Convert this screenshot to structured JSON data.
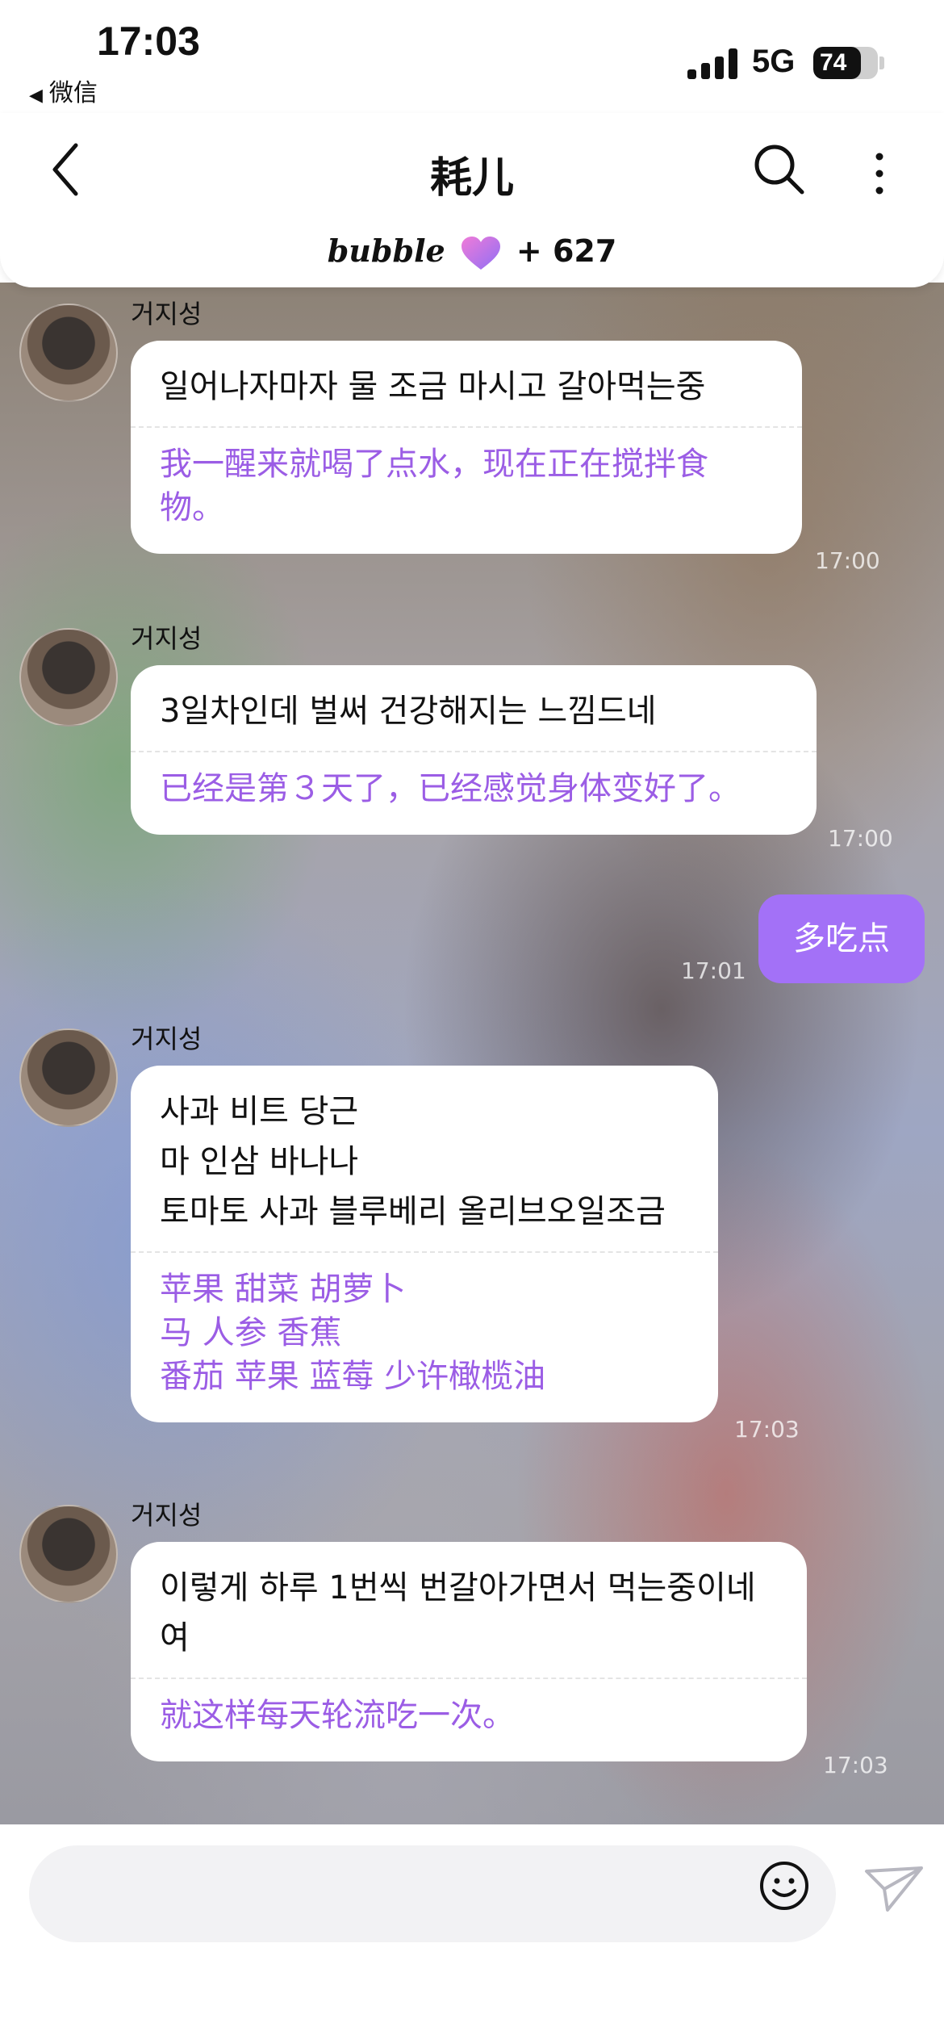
{
  "status_bar": {
    "time": "17:03",
    "back_app": "微信",
    "network": "5G",
    "battery": "74",
    "battery_level": 0.74
  },
  "header": {
    "title": "耗儿",
    "bubble_logo": "bubble",
    "plus_count": "+ 627"
  },
  "colors": {
    "accent": "#a371f7",
    "translation_text": "#9b5de5",
    "bubble_bg": "#ffffff"
  },
  "messages": [
    {
      "sender": "거지성",
      "korean": "일어나자마자 물 조금 마시고 갈아먹는중",
      "translation": "我一醒来就喝了点水，现在正在搅拌食\n物。",
      "time": "17:00"
    },
    {
      "sender": "거지성",
      "korean": "3일차인데 벌써 건강해지는 느낌드네",
      "translation": "已经是第３天了，已经感觉身体变好了。",
      "time": "17:00"
    },
    {
      "sender": "거지성",
      "korean": "사과 비트 당근\n마 인삼 바나나\n토마토 사과 블루베리 올리브오일조금",
      "translation": "苹果 甜菜 胡萝卜\n马 人参 香蕉\n番茄 苹果 蓝莓 少许橄榄油",
      "time": "17:03"
    },
    {
      "sender": "거지성",
      "korean": "이렇게 하루 1번씩 번갈아가면서 먹는중이네\n여",
      "translation": "就这样每天轮流吃一次。",
      "time": "17:03"
    }
  ],
  "my_message": {
    "text": "多吃点",
    "time": "17:01"
  },
  "icons": {
    "back": "chevron-left-icon",
    "search": "search-icon",
    "more": "more-vertical-icon",
    "emoji": "smiley-icon",
    "send": "paper-plane-icon",
    "heart": "heart-icon"
  }
}
